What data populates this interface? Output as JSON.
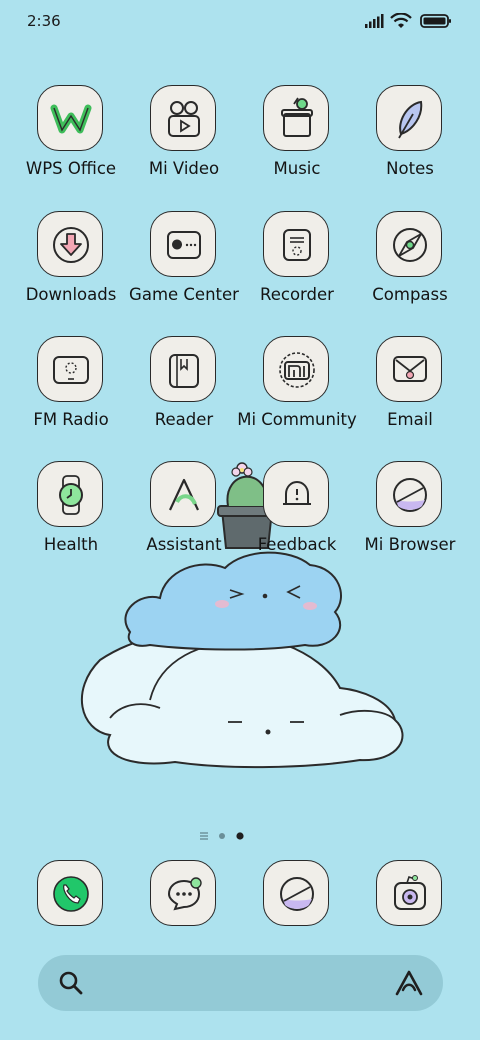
{
  "status_bar": {
    "time": "2:36",
    "icons": [
      "signal-icon",
      "wifi-icon",
      "battery-icon"
    ]
  },
  "apps": [
    {
      "label": "WPS Office",
      "icon": "wps-office-icon"
    },
    {
      "label": "Mi Video",
      "icon": "mi-video-icon"
    },
    {
      "label": "Music",
      "icon": "music-icon"
    },
    {
      "label": "Notes",
      "icon": "notes-icon"
    },
    {
      "label": "Downloads",
      "icon": "downloads-icon"
    },
    {
      "label": "Game Center",
      "icon": "game-center-icon"
    },
    {
      "label": "Recorder",
      "icon": "recorder-icon"
    },
    {
      "label": "Compass",
      "icon": "compass-icon"
    },
    {
      "label": "FM Radio",
      "icon": "fm-radio-icon"
    },
    {
      "label": "Reader",
      "icon": "reader-icon"
    },
    {
      "label": "Mi Community",
      "icon": "mi-community-icon"
    },
    {
      "label": "Email",
      "icon": "email-icon"
    },
    {
      "label": "Health",
      "icon": "health-icon"
    },
    {
      "label": "Assistant",
      "icon": "assistant-icon"
    },
    {
      "label": "Feedback",
      "icon": "feedback-icon"
    },
    {
      "label": "Mi Browser",
      "icon": "mi-browser-icon"
    }
  ],
  "page_indicator": {
    "pages": 3,
    "current": 3,
    "first_is_feed": true
  },
  "dock": [
    {
      "icon": "phone-icon"
    },
    {
      "icon": "messages-icon"
    },
    {
      "icon": "browser-icon"
    },
    {
      "icon": "camera-icon"
    }
  ],
  "search_bar": {
    "icon_left": "search-icon",
    "icon_right": "assistant-icon"
  },
  "colors": {
    "background": "#ade2ee",
    "tile": "#f0eee9",
    "accent_green": "#79d68a",
    "accent_purple": "#c9b8f0"
  }
}
